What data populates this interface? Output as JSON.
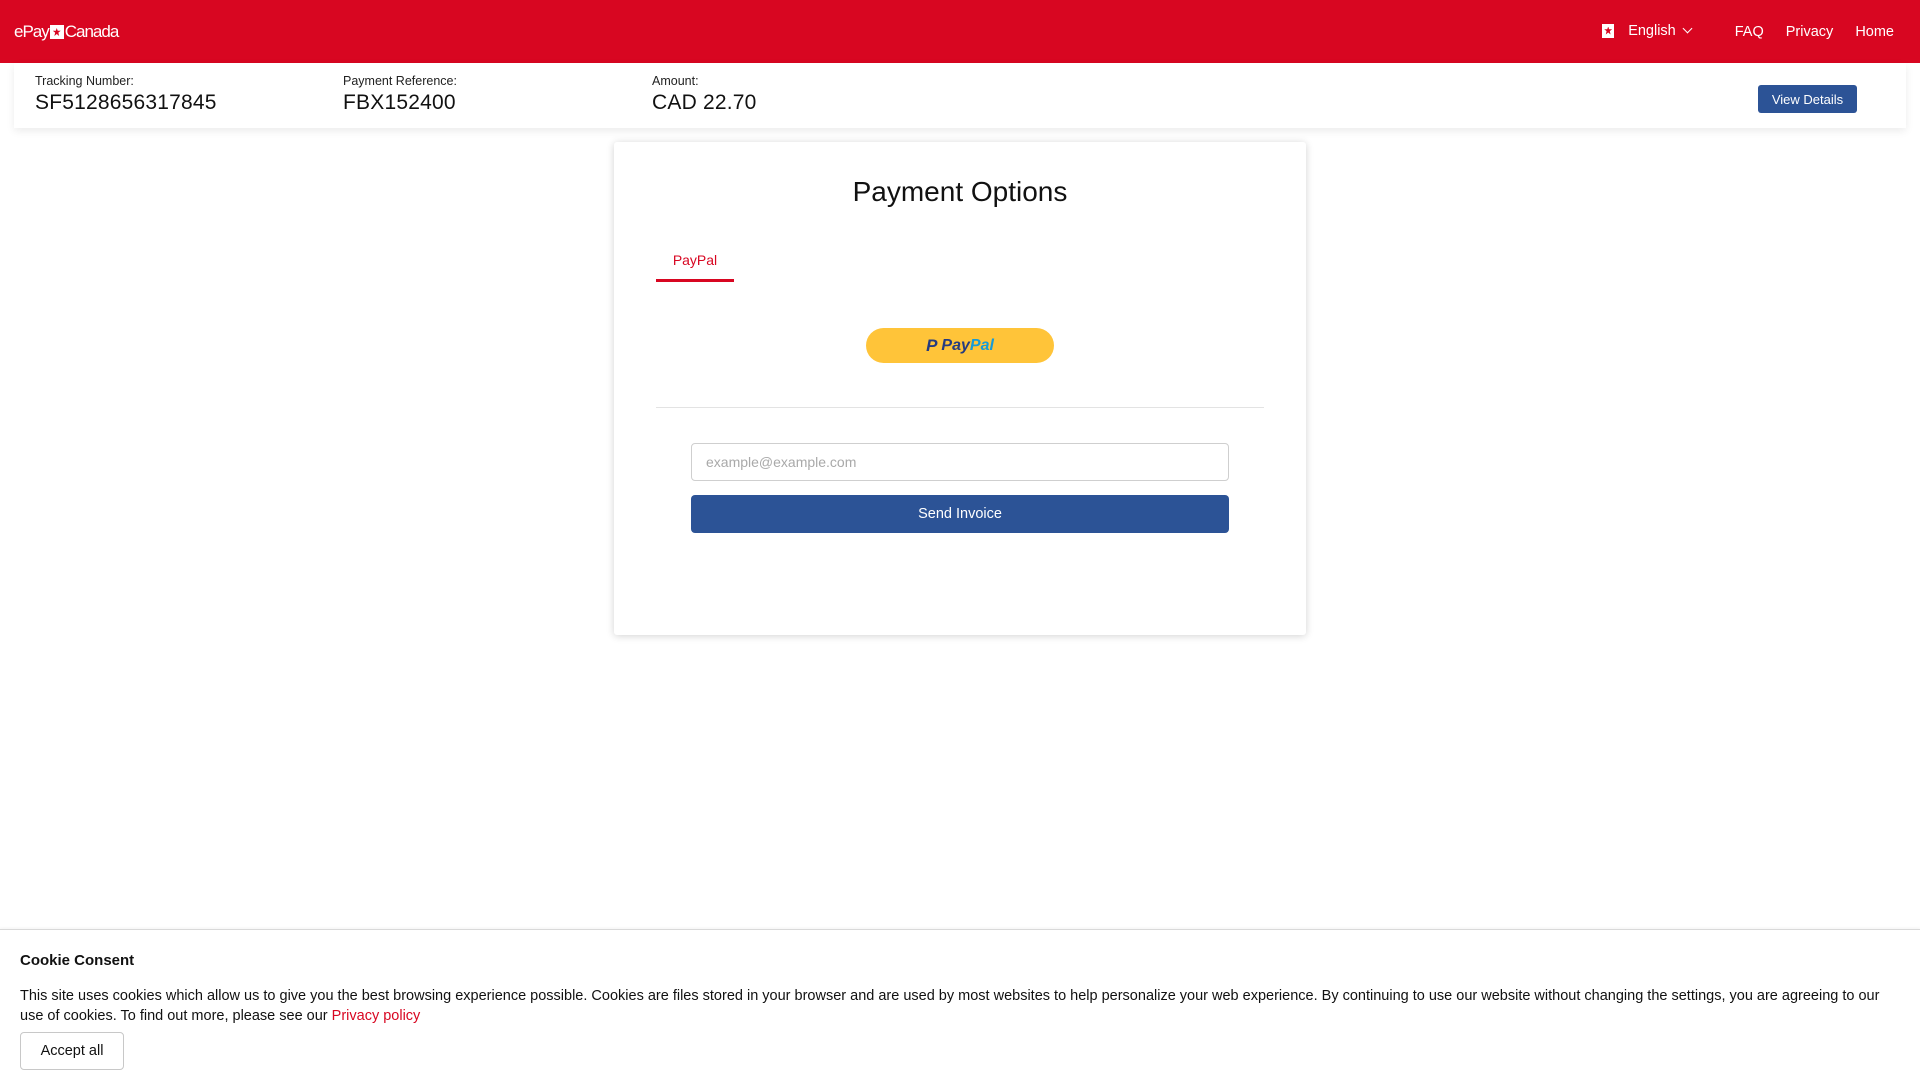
{
  "header": {
    "logo_text_left": "ePay",
    "logo_text_right": "Canada",
    "language": "English",
    "nav": [
      "FAQ",
      "Privacy",
      "Home"
    ]
  },
  "info": {
    "tracking_label": "Tracking Number:",
    "tracking_value": "SF5128656317845",
    "reference_label": "Payment Reference:",
    "reference_value": "FBX152400",
    "amount_label": "Amount:",
    "amount_value": "CAD 22.70",
    "details_button": "View Details"
  },
  "card": {
    "title": "Payment Options",
    "tab": "PayPal",
    "paypal_button": {
      "p_mark": "P",
      "pay": "Pay",
      "pal": "Pal"
    },
    "email_placeholder": "example@example.com",
    "send_button": "Send Invoice"
  },
  "cookie": {
    "title": "Cookie Consent",
    "text": "This site uses cookies which allow us to give you the best browsing experience possible. Cookies are files stored in your browser and are used by most websites to help personalize your web experience. By continuing to use our website without changing the settings, you are agreeing to our use of cookies. To find out more, please see our ",
    "link": "Privacy policy",
    "accept_button": "Accept all"
  },
  "colors": {
    "brand_red": "#d80621",
    "button_blue": "#2c5396",
    "paypal_yellow": "#ffc439"
  }
}
